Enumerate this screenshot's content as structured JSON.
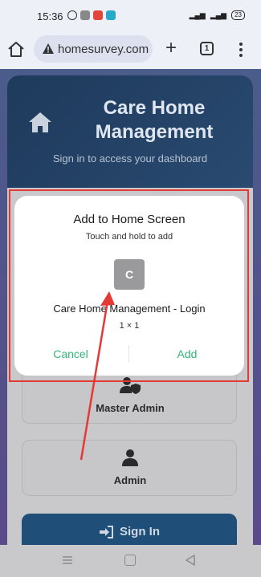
{
  "status_bar": {
    "time": "15:36",
    "battery": "23"
  },
  "browser": {
    "url": "homesurvey.com",
    "tab_count": "1"
  },
  "card": {
    "title": "Care Home Management",
    "subtitle": "Sign in to access your dashboard",
    "roles": [
      {
        "label": "Master Admin"
      },
      {
        "label": "Admin"
      }
    ],
    "signin_label": "Sign In"
  },
  "dialog": {
    "title": "Add to Home Screen",
    "subtitle": "Touch and hold to add",
    "icon_letter": "C",
    "app_name": "Care Home Management - Login",
    "app_size": "1 × 1",
    "cancel_label": "Cancel",
    "add_label": "Add"
  },
  "colors": {
    "accent_green": "#35b57a",
    "highlight_red": "#e53935",
    "header_navy": "#1e3a5c"
  }
}
